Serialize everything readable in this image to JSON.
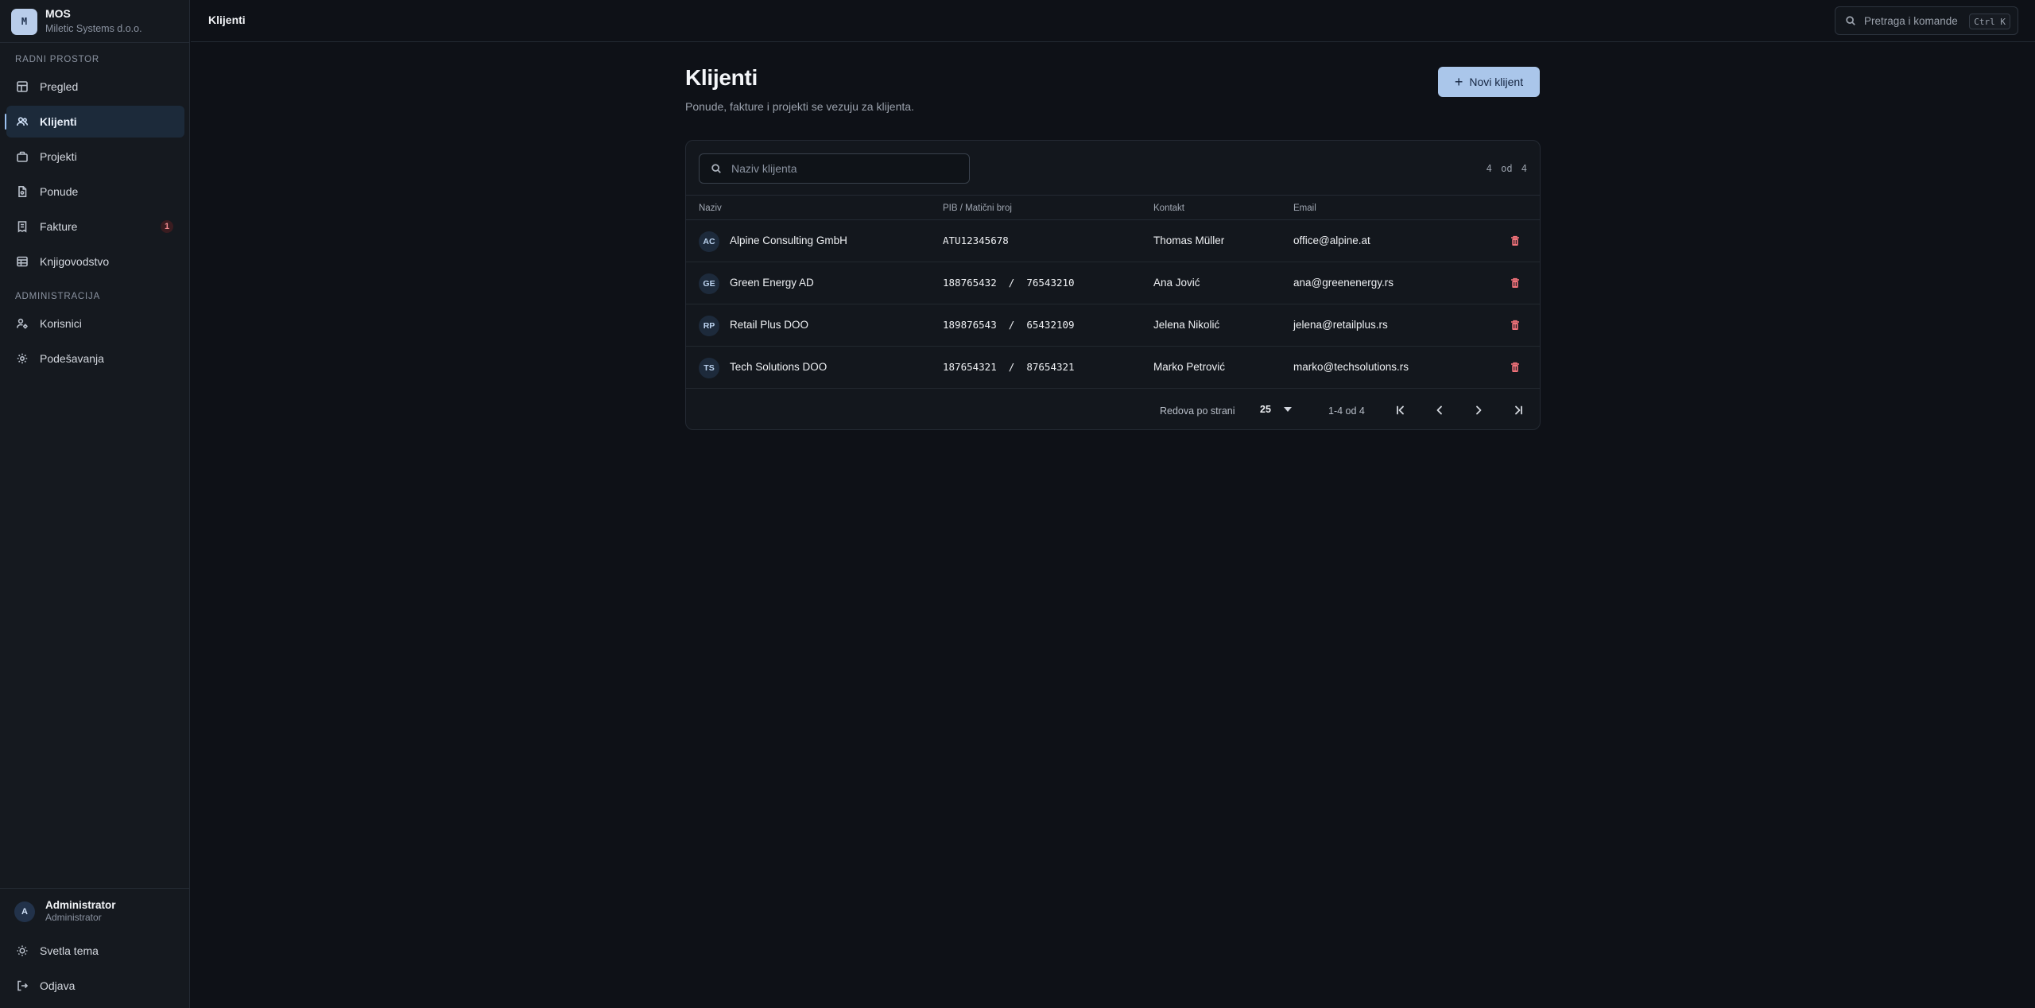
{
  "brand": {
    "logo": "M",
    "name": "MOS",
    "company": "Miletic Systems d.o.o."
  },
  "sidebar": {
    "sections": [
      {
        "label": "Radni prostor"
      },
      {
        "label": "Administracija"
      }
    ],
    "items": [
      {
        "label": "Pregled",
        "icon": "dashboard-icon"
      },
      {
        "label": "Klijenti",
        "icon": "users-icon",
        "active": true
      },
      {
        "label": "Projekti",
        "icon": "briefcase-icon"
      },
      {
        "label": "Ponude",
        "icon": "document-icon"
      },
      {
        "label": "Fakture",
        "icon": "receipt-icon",
        "badge": "1"
      },
      {
        "label": "Knjigovodstvo",
        "icon": "table-icon"
      },
      {
        "label": "Korisnici",
        "icon": "user-gear-icon"
      },
      {
        "label": "Podešavanja",
        "icon": "gear-icon"
      }
    ],
    "user": {
      "initial": "A",
      "name": "Administrator",
      "role": "Administrator"
    },
    "theme_label": "Svetla tema",
    "logout_label": "Odjava"
  },
  "topbar": {
    "title": "Klijenti",
    "search_placeholder": "Pretraga i komande",
    "shortcut": "Ctrl K"
  },
  "page": {
    "title": "Klijenti",
    "subtitle": "Ponude, fakture i projekti se vezuju za klijenta.",
    "new_button": "Novi klijent"
  },
  "table": {
    "search_placeholder": "Naziv klijenta",
    "count": "4 od 4",
    "headers": {
      "name": "Naziv",
      "pib": "PIB / Matični broj",
      "contact": "Kontakt",
      "email": "Email"
    },
    "rows": [
      {
        "initials": "AC",
        "name": "Alpine Consulting GmbH",
        "pib": "ATU12345678",
        "contact": "Thomas Müller",
        "email": "office@alpine.at"
      },
      {
        "initials": "GE",
        "name": "Green Energy AD",
        "pib": "188765432  /  76543210",
        "contact": "Ana Jović",
        "email": "ana@greenenergy.rs"
      },
      {
        "initials": "RP",
        "name": "Retail Plus DOO",
        "pib": "189876543  /  65432109",
        "contact": "Jelena Nikolić",
        "email": "jelena@retailplus.rs"
      },
      {
        "initials": "TS",
        "name": "Tech Solutions DOO",
        "pib": "187654321  /  87654321",
        "contact": "Marko Petrović",
        "email": "marko@techsolutions.rs"
      }
    ],
    "footer": {
      "rows_per_page_label": "Redova po strani",
      "rows_per_page": "25",
      "range": "1-4 od 4"
    }
  },
  "colors": {
    "accent": "#aac6ea",
    "danger": "#f0727a",
    "background": "#0e1117",
    "sidebar": "#15191f"
  }
}
